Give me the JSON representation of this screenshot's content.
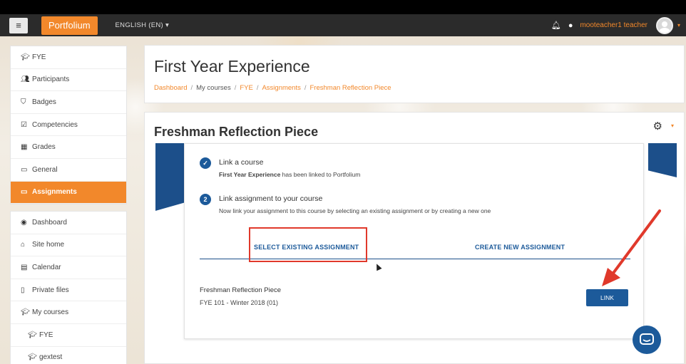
{
  "navbar": {
    "brand": "Portfolium",
    "language": "ENGLISH (EN)",
    "user_name": "mooteacher1 teacher"
  },
  "sidebar": {
    "course_items": [
      {
        "label": "FYE",
        "icon": "graduation-cap-icon"
      },
      {
        "label": "Participants",
        "icon": "users-icon"
      },
      {
        "label": "Badges",
        "icon": "shield-icon"
      },
      {
        "label": "Competencies",
        "icon": "check-square-icon"
      },
      {
        "label": "Grades",
        "icon": "table-icon"
      },
      {
        "label": "General",
        "icon": "folder-icon"
      },
      {
        "label": "Assignments",
        "icon": "folder-icon"
      }
    ],
    "site_items": [
      {
        "label": "Dashboard",
        "icon": "tachometer-icon"
      },
      {
        "label": "Site home",
        "icon": "home-icon"
      },
      {
        "label": "Calendar",
        "icon": "calendar-icon"
      },
      {
        "label": "Private files",
        "icon": "file-icon"
      },
      {
        "label": "My courses",
        "icon": "graduation-cap-icon"
      },
      {
        "label": "FYE",
        "icon": "graduation-cap-icon"
      },
      {
        "label": "gextest",
        "icon": "graduation-cap-icon"
      }
    ]
  },
  "header": {
    "title": "First Year Experience",
    "breadcrumb": [
      "Dashboard",
      "My courses",
      "FYE",
      "Assignments",
      "Freshman Reflection Piece"
    ]
  },
  "main": {
    "title": "Freshman Reflection Piece",
    "steps": [
      {
        "badge": "✓",
        "title": "Link a course",
        "desc_bold": "First Year Experience",
        "desc": " has been linked to Portfolium"
      },
      {
        "badge": "2",
        "title": "Link assignment to your course",
        "desc": "Now link your assignment to this course by selecting an existing assignment or by creating a new one"
      }
    ],
    "tabs": [
      "SELECT EXISTING ASSIGNMENT",
      "CREATE NEW ASSIGNMENT"
    ],
    "assignment": {
      "name": "Freshman Reflection Piece",
      "course": "FYE 101 - Winter 2018 (01)"
    },
    "link_button": "LINK"
  },
  "colors": {
    "accent": "#f2882b",
    "primary": "#1c5a9a",
    "annotation": "#e0392b"
  }
}
